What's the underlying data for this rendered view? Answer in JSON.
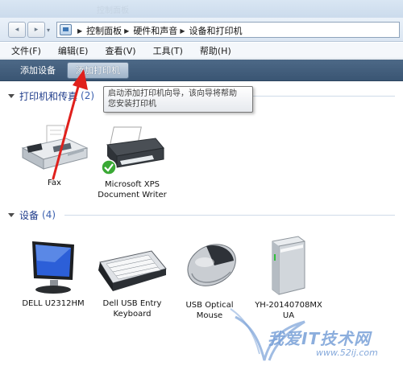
{
  "window": {
    "faded_title": "控制面板"
  },
  "nav": {
    "back_glyph": "◂",
    "forward_glyph": "▸",
    "dropdown_glyph": "▾"
  },
  "breadcrumb": {
    "items": [
      "控制面板",
      "硬件和声音",
      "设备和打印机"
    ],
    "separator": "▶"
  },
  "menu": {
    "items": [
      "文件(F)",
      "编辑(E)",
      "查看(V)",
      "工具(T)",
      "帮助(H)"
    ]
  },
  "commandbar": {
    "add_device": "添加设备",
    "add_printer": "添加打印机"
  },
  "tooltip": {
    "line1": "启动添加打印机向导，该向导将帮助",
    "line2": "您安装打印机"
  },
  "printers_group": {
    "title": "打印机和传真",
    "count": "(2)",
    "items": [
      {
        "name_lines": [
          "Fax"
        ],
        "icon": "fax-icon"
      },
      {
        "name_lines": [
          "Microsoft XPS",
          "Document Writer"
        ],
        "icon": "printer-default-icon"
      }
    ]
  },
  "devices_group": {
    "title": "设备",
    "count": "(4)",
    "items": [
      {
        "name_lines": [
          "DELL U2312HM"
        ],
        "icon": "monitor-icon"
      },
      {
        "name_lines": [
          "Dell USB Entry",
          "Keyboard"
        ],
        "icon": "keyboard-icon"
      },
      {
        "name_lines": [
          "USB Optical",
          "Mouse"
        ],
        "icon": "mouse-icon"
      },
      {
        "name_lines": [
          "YH-20140708MX",
          "UA"
        ],
        "icon": "computer-tower-icon"
      }
    ]
  },
  "watermark": {
    "text": "我爱IT技术网",
    "url": "www.52ij.com"
  },
  "colors": {
    "command_bar": "#3f5b79",
    "group_title": "#1e3b8a",
    "arrow": "#e0201c"
  }
}
